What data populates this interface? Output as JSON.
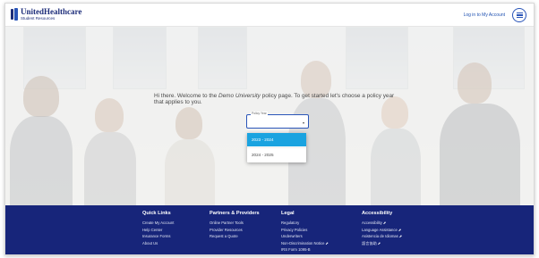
{
  "header": {
    "brand_name": "UnitedHealthcare",
    "brand_sub": "Student Resources",
    "login_link": "Log in to My Account",
    "menu_icon": "hamburger-menu-icon",
    "accent_color": "#2a55b8"
  },
  "hero": {
    "welcome_prefix": "Hi there. Welcome to the ",
    "welcome_university": "Demo University",
    "welcome_suffix": " policy page. To get started let's choose a policy year that applies to you.",
    "select": {
      "label": "Policy Year",
      "value": ""
    },
    "dropdown": {
      "options": [
        "2023 - 2024",
        "2024 - 2025"
      ],
      "highlighted_index": 0,
      "highlight_color": "#1aa3e0"
    }
  },
  "footer": {
    "background_color": "#17257a",
    "columns": [
      {
        "title": "Quick Links",
        "links": [
          "Create My Account",
          "Help Center",
          "Insurance Forms",
          "About Us"
        ]
      },
      {
        "title": "Partners & Providers",
        "links": [
          "Online Partner Tools",
          "Provider Resources",
          "Request a Quote"
        ]
      },
      {
        "title": "Legal",
        "links": [
          "Regulatory",
          "Privacy Policies",
          "Underwriters",
          "Non-Discrimination Notice",
          "IRS Form 1095-B"
        ]
      },
      {
        "title": "Accessibility",
        "links": [
          "Accessibility",
          "Language Assistance",
          "Asistencia de Idiomas",
          "語言協助"
        ]
      }
    ],
    "external_link_icon": "external-link-icon",
    "external_marker": "⬈"
  }
}
